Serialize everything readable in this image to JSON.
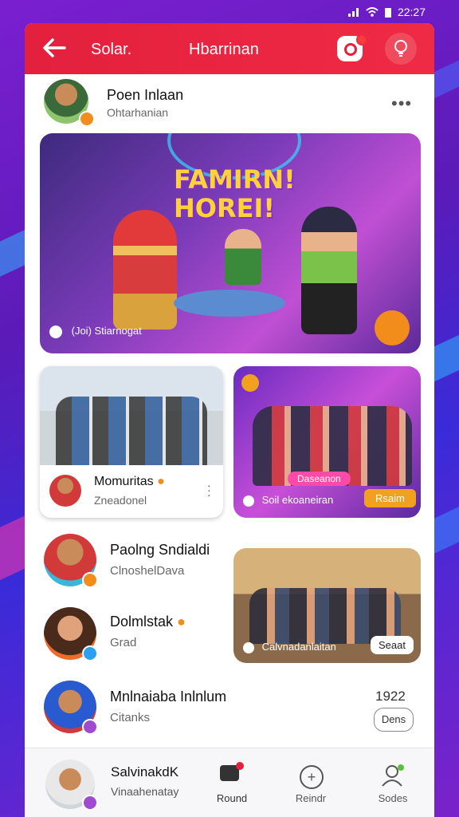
{
  "status_bar": {
    "time": "22:27"
  },
  "header": {
    "back_label": "Solar.",
    "title": "Hbarrinan"
  },
  "post": {
    "author": "Poen Inlaan",
    "subtitle": "Ohtarhanian",
    "hero_title_line1": "FAMIRN!",
    "hero_title_line2": "HOREI!",
    "hero_caption": "(Joi) Stiarnogat"
  },
  "cards": [
    {
      "title": "Momuritas",
      "subtitle": "Zneadonel"
    },
    {
      "caption": "Soil ekoaneiran",
      "pill": "Rsaim",
      "banner": "Daseanon"
    }
  ],
  "contacts": [
    {
      "name": "Paolng Sndialdi",
      "subtitle": "ClnoshelDava"
    },
    {
      "name": "Dolmlstak",
      "subtitle": "Grad"
    },
    {
      "name": "Mnlnaiaba Inlnlum",
      "subtitle": "Citanks",
      "meta": "1922",
      "button": "Dens"
    }
  ],
  "media_card": {
    "caption": "Calvnadanlaitan",
    "button": "Seaat"
  },
  "bottom": {
    "profile_name": "SalvinakdK",
    "profile_sub": "Vinaahenatay",
    "nav": [
      "Round",
      "Reindr",
      "Sodes"
    ]
  },
  "colors": {
    "brand": "#e3203d",
    "accent": "#f28c1a",
    "background": "#6a1fc8"
  }
}
